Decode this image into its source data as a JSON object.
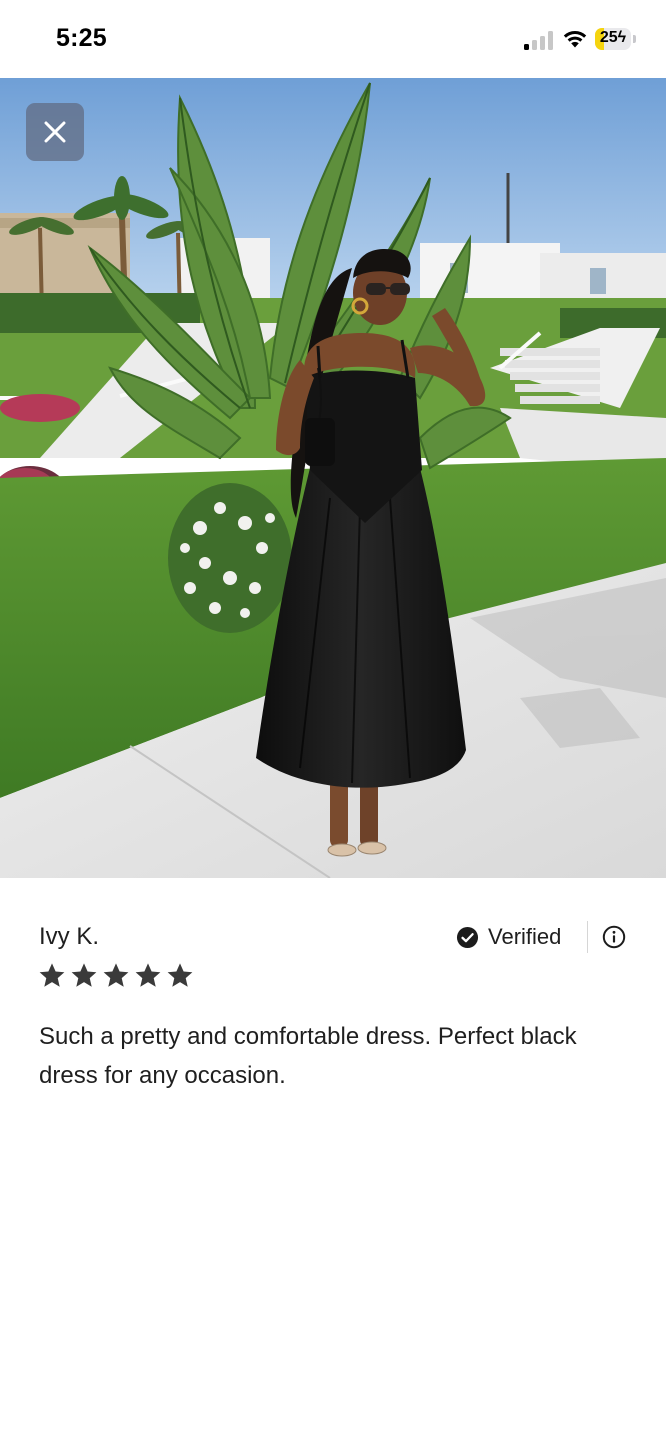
{
  "status_bar": {
    "time": "5:25",
    "battery_percent": "25",
    "signal_bars_active": 1,
    "signal_bars_total": 4,
    "battery_fill_color": "#f5d40f",
    "icons": [
      "cellular-signal-icon",
      "wifi-icon",
      "battery-charging-icon"
    ]
  },
  "photo": {
    "close_icon": "close-icon"
  },
  "review": {
    "reviewer_name": "Ivy K.",
    "verified_label": "Verified",
    "verified_icon": "check-circle-icon",
    "info_icon": "info-icon",
    "rating": 5,
    "rating_max": 5,
    "star_color": "#3a3a3a",
    "text": "Such a pretty and comfortable dress. Perfect black dress for any occasion."
  }
}
